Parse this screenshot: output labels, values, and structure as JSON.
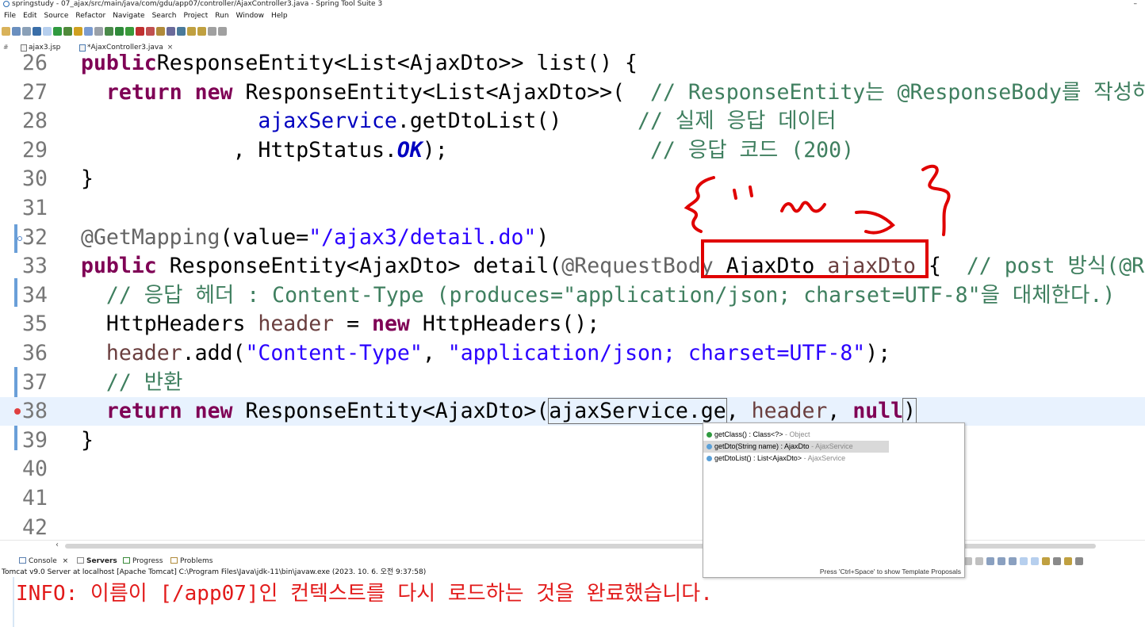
{
  "window": {
    "title": "springstudy - 07_ajax/src/main/java/com/gdu/app07/controller/AjaxController3.java - Spring Tool Suite 3",
    "minimize_glyph": "–"
  },
  "menu": [
    "File",
    "Edit",
    "Source",
    "Refactor",
    "Navigate",
    "Search",
    "Project",
    "Run",
    "Window",
    "Help"
  ],
  "editor_tabs": [
    {
      "label": "ajax3.jsp",
      "active": false
    },
    {
      "label": "*AjaxController3.java",
      "active": true,
      "close": "×"
    }
  ],
  "code_lines": [
    {
      "num": "26",
      "parts": [
        [
          "kw",
          "public"
        ],
        [
          "",
          "ResponseEntity<List<AjaxDto>> list() {"
        ]
      ]
    },
    {
      "num": "27",
      "parts": [
        [
          "",
          "  "
        ],
        [
          "kw",
          "return"
        ],
        [
          "",
          " "
        ],
        [
          "kw",
          "new"
        ],
        [
          "",
          " ResponseEntity<List<AjaxDto>>(  "
        ],
        [
          "cmt",
          "// ResponseEntity는 @ResponseBody를 작성하지 않는다."
        ]
      ]
    },
    {
      "num": "28",
      "parts": [
        [
          "",
          "              "
        ],
        [
          "fld",
          "ajaxService"
        ],
        [
          "",
          ".getDtoList()      "
        ],
        [
          "cmt",
          "// 실제 응답 데이터"
        ]
      ]
    },
    {
      "num": "29",
      "parts": [
        [
          "",
          "            , HttpStatus."
        ],
        [
          "stat",
          "OK"
        ],
        [
          "",
          ");                "
        ],
        [
          "cmt",
          "// 응답 코드 (200)"
        ]
      ]
    },
    {
      "num": "30",
      "parts": [
        [
          "",
          "}"
        ]
      ]
    },
    {
      "num": "31",
      "parts": []
    },
    {
      "num": "32",
      "parts": [
        [
          "ann",
          "@GetMapping"
        ],
        [
          "",
          "(value="
        ],
        [
          "str",
          "\"/ajax3/detail.do\""
        ],
        [
          "",
          ")"
        ]
      ]
    },
    {
      "num": "33",
      "parts": [
        [
          "kw",
          "public"
        ],
        [
          "",
          " ResponseEntity<AjaxDto> detail("
        ],
        [
          "ann",
          "@RequestBody"
        ],
        [
          "",
          " AjaxDto "
        ],
        [
          "lv",
          "ajaxDto"
        ],
        [
          "",
          " {  "
        ],
        [
          "cmt",
          "// post 방식(@RequestBody)"
        ]
      ]
    },
    {
      "num": "34",
      "parts": [
        [
          "",
          "  "
        ],
        [
          "cmt",
          "// 응답 헤더 : Content-Type (produces=\"application/json; charset=UTF-8\"을 대체한다.)"
        ]
      ]
    },
    {
      "num": "35",
      "parts": [
        [
          "",
          "  HttpHeaders "
        ],
        [
          "lv",
          "header"
        ],
        [
          "",
          " = "
        ],
        [
          "kw",
          "new"
        ],
        [
          "",
          " HttpHeaders();"
        ]
      ]
    },
    {
      "num": "36",
      "parts": [
        [
          "",
          "  "
        ],
        [
          "lv",
          "header"
        ],
        [
          "",
          ".add("
        ],
        [
          "str",
          "\"Content-Type\""
        ],
        [
          "",
          ", "
        ],
        [
          "str",
          "\"application/json; charset=UTF-8\""
        ],
        [
          "",
          ");"
        ]
      ]
    },
    {
      "num": "37",
      "parts": [
        [
          "",
          "  "
        ],
        [
          "cmt",
          "// 반환"
        ]
      ]
    },
    {
      "num": "38",
      "parts": [
        [
          "",
          "  "
        ],
        [
          "kw",
          "return"
        ],
        [
          "",
          " "
        ],
        [
          "kw",
          "new"
        ],
        [
          "",
          " ResponseEntity<AjaxDto>("
        ],
        [
          "sel",
          "ajaxService.ge"
        ],
        [
          "",
          ", "
        ],
        [
          "lv",
          "header"
        ],
        [
          "",
          ", "
        ],
        [
          "kw",
          "null"
        ],
        [
          ")",
          ")"
        ]
      ]
    },
    {
      "num": "39",
      "parts": [
        [
          "",
          "}"
        ]
      ]
    },
    {
      "num": "40",
      "parts": []
    },
    {
      "num": "41",
      "parts": []
    },
    {
      "num": "42",
      "parts": []
    }
  ],
  "content_assist": {
    "proposals": [
      {
        "icon": "green",
        "signature": "getClass() : Class<?>",
        "owner": " - Object"
      },
      {
        "icon": "blue",
        "signature": "getDto(String name) : AjaxDto",
        "owner": " - AjaxService",
        "selected": true
      },
      {
        "icon": "blue",
        "signature": "getDtoList() : List<AjaxDto>",
        "owner": " - AjaxService"
      }
    ],
    "status": "Press 'Ctrl+Space' to show Template Proposals"
  },
  "console_tabs": [
    {
      "label": "Console",
      "close": "×"
    },
    {
      "label": "Servers"
    },
    {
      "label": "Progress"
    },
    {
      "label": "Problems"
    }
  ],
  "console": {
    "header": "Tomcat v9.0 Server at localhost [Apache Tomcat] C:\\Program Files\\Java\\jdk-11\\bin\\javaw.exe  (2023. 10. 6. 오전 9:37:58)",
    "line": "INFO: 이름이 [/app07]인 컨텍스트를 다시 로드하는 것을 완료했습니다."
  },
  "colors": {
    "keyword": "#7f0055",
    "string": "#2a00ff",
    "comment": "#3f7f5f",
    "annotation_red": "#e00000",
    "console_text": "#e21a1a"
  }
}
